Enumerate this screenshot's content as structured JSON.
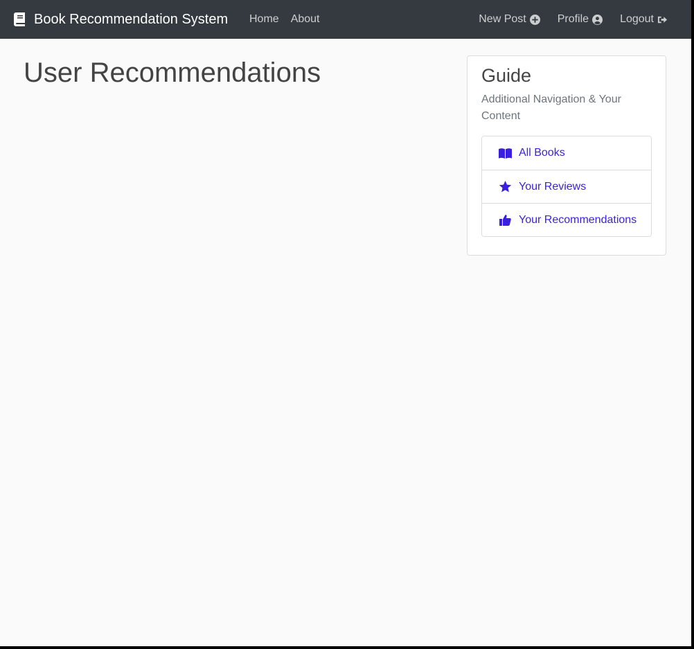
{
  "navbar": {
    "brand": "Book Recommendation System",
    "brand_icon": "book-icon",
    "links_left": [
      {
        "label": "Home"
      },
      {
        "label": "About"
      }
    ],
    "links_right": [
      {
        "label": "New Post",
        "icon": "plus-circle-icon"
      },
      {
        "label": "Profile",
        "icon": "user-circle-icon"
      },
      {
        "label": "Logout",
        "icon": "sign-out-icon"
      }
    ],
    "colors": {
      "background": "#343a40",
      "link": "rgba(255,255,255,0.75)"
    }
  },
  "main": {
    "title": "User Recommendations"
  },
  "guide": {
    "title": "Guide",
    "subtitle": "Additional Navigation & Your Content",
    "items": [
      {
        "label": "All Books",
        "icon": "book-open-icon"
      },
      {
        "label": "Your Reviews",
        "icon": "star-icon"
      },
      {
        "label": "Your Recommendations",
        "icon": "thumbs-up-icon"
      }
    ],
    "link_color": "#3a1fe0"
  }
}
